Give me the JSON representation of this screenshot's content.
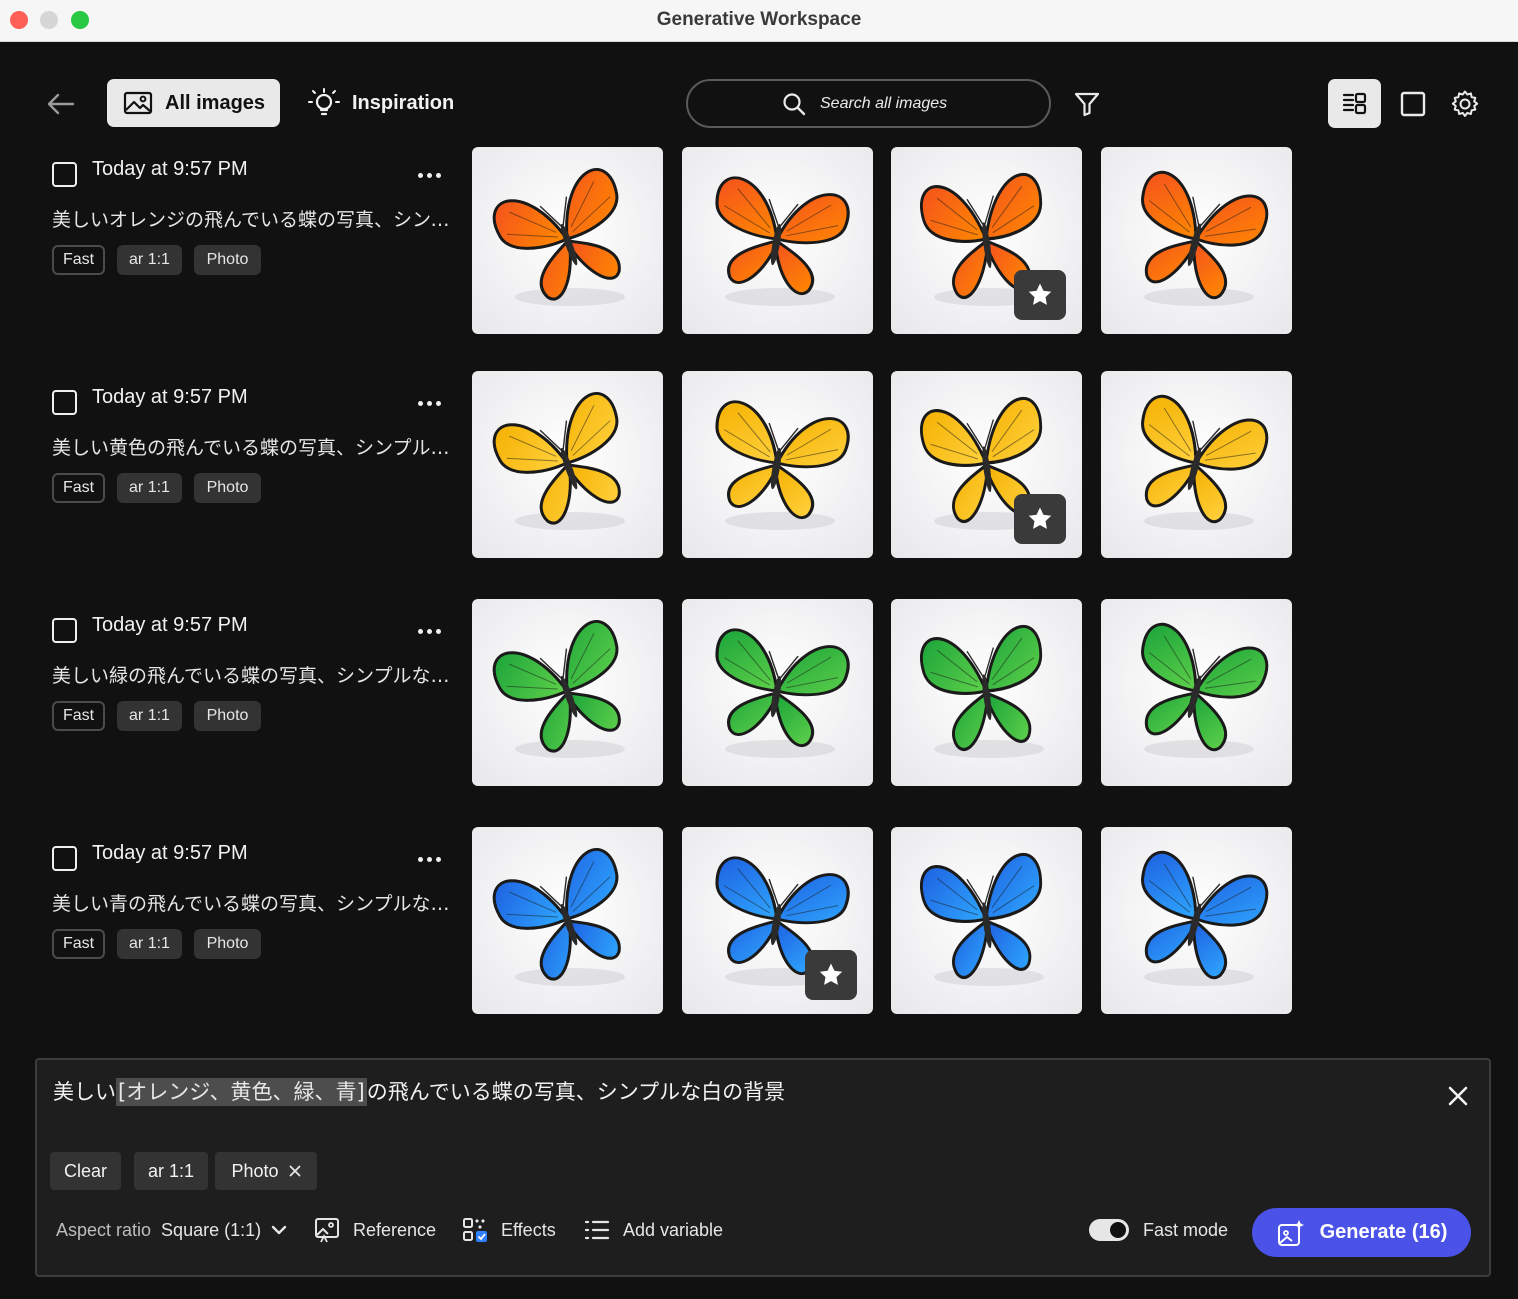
{
  "window": {
    "title": "Generative Workspace"
  },
  "toolbar": {
    "back_icon": "arrow-left-icon",
    "tabs": [
      {
        "label": "All images",
        "icon": "image-icon",
        "active": true
      },
      {
        "label": "Inspiration",
        "icon": "lightbulb-icon",
        "active": false
      }
    ],
    "search": {
      "placeholder": "Search all images",
      "icon": "search-icon"
    },
    "filter_icon": "filter-icon",
    "view_list_icon": "list-view-icon",
    "view_single_icon": "single-view-icon",
    "settings_icon": "gear-icon"
  },
  "generations": [
    {
      "timestamp": "Today at 9:57 PM",
      "prompt": "美しいオレンジの飛んでいる蝶の写真、シンプルな白の背景",
      "tags": [
        "Fast",
        "ar 1:1",
        "Photo"
      ],
      "color": "orange",
      "wing": "#f4511e",
      "wing2": "#ff8a00",
      "favorite_index": 2
    },
    {
      "timestamp": "Today at 9:57 PM",
      "prompt": "美しい黄色の飛んでいる蝶の写真、シンプルな白の背景",
      "tags": [
        "Fast",
        "ar 1:1",
        "Photo"
      ],
      "color": "yellow",
      "wing": "#f5b000",
      "wing2": "#ffd23f",
      "favorite_index": 2
    },
    {
      "timestamp": "Today at 9:57 PM",
      "prompt": "美しい緑の飛んでいる蝶の写真、シンプルな白の背景",
      "tags": [
        "Fast",
        "ar 1:1",
        "Photo"
      ],
      "color": "green",
      "wing": "#1aa33a",
      "wing2": "#5fd14a",
      "favorite_index": -1
    },
    {
      "timestamp": "Today at 9:57 PM",
      "prompt": "美しい青の飛んでいる蝶の写真、シンプルな白の背景",
      "tags": [
        "Fast",
        "ar 1:1",
        "Photo"
      ],
      "color": "blue",
      "wing": "#1e5fe0",
      "wing2": "#2fa8ff",
      "favorite_index": 1
    }
  ],
  "prompt_panel": {
    "prefix": "美しい",
    "variable": "[オレンジ、黄色、緑、青]",
    "suffix": "の飛んでいる蝶の写真、シンプルな白の背景",
    "close_icon": "close-icon",
    "chips": {
      "clear": "Clear",
      "ar": "ar 1:1",
      "photo": "Photo"
    },
    "aspect_label": "Aspect ratio",
    "aspect_value": "Square (1:1)",
    "reference": "Reference",
    "effects": "Effects",
    "add_variable": "Add variable",
    "fast_mode": "Fast mode",
    "fast_mode_on": true,
    "generate": "Generate (16)",
    "generate_color": "#4a52e8"
  }
}
